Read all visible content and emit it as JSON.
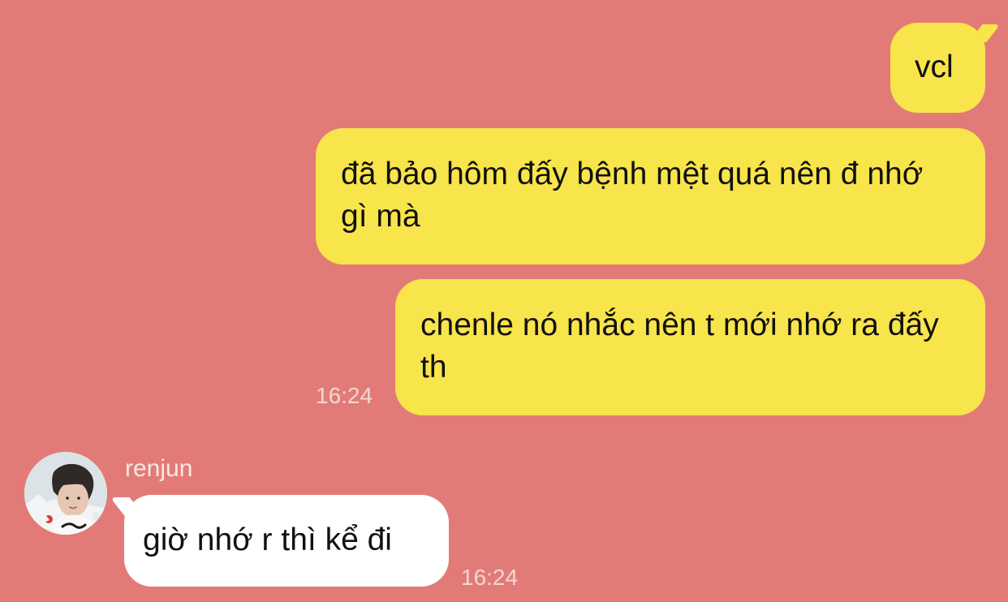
{
  "colors": {
    "background": "#E27B78",
    "outgoing_bubble": "#F8E44B",
    "incoming_bubble": "#FFFFFF",
    "timestamp": "#F2D7D3",
    "sender_name": "#F7E7E3"
  },
  "conversation": {
    "outgoing": [
      {
        "text": "vcl"
      },
      {
        "text": "đã bảo hôm đấy bệnh mệt quá nên đ nhớ gì mà"
      },
      {
        "text": "chenle nó nhắc nên t mới nhớ ra đấy th",
        "time": "16:24"
      }
    ],
    "incoming": {
      "sender": "renjun",
      "avatar_icon": "avatar-photo-icon",
      "text": "giờ nhớ r thì kể đi",
      "time": "16:24"
    }
  }
}
